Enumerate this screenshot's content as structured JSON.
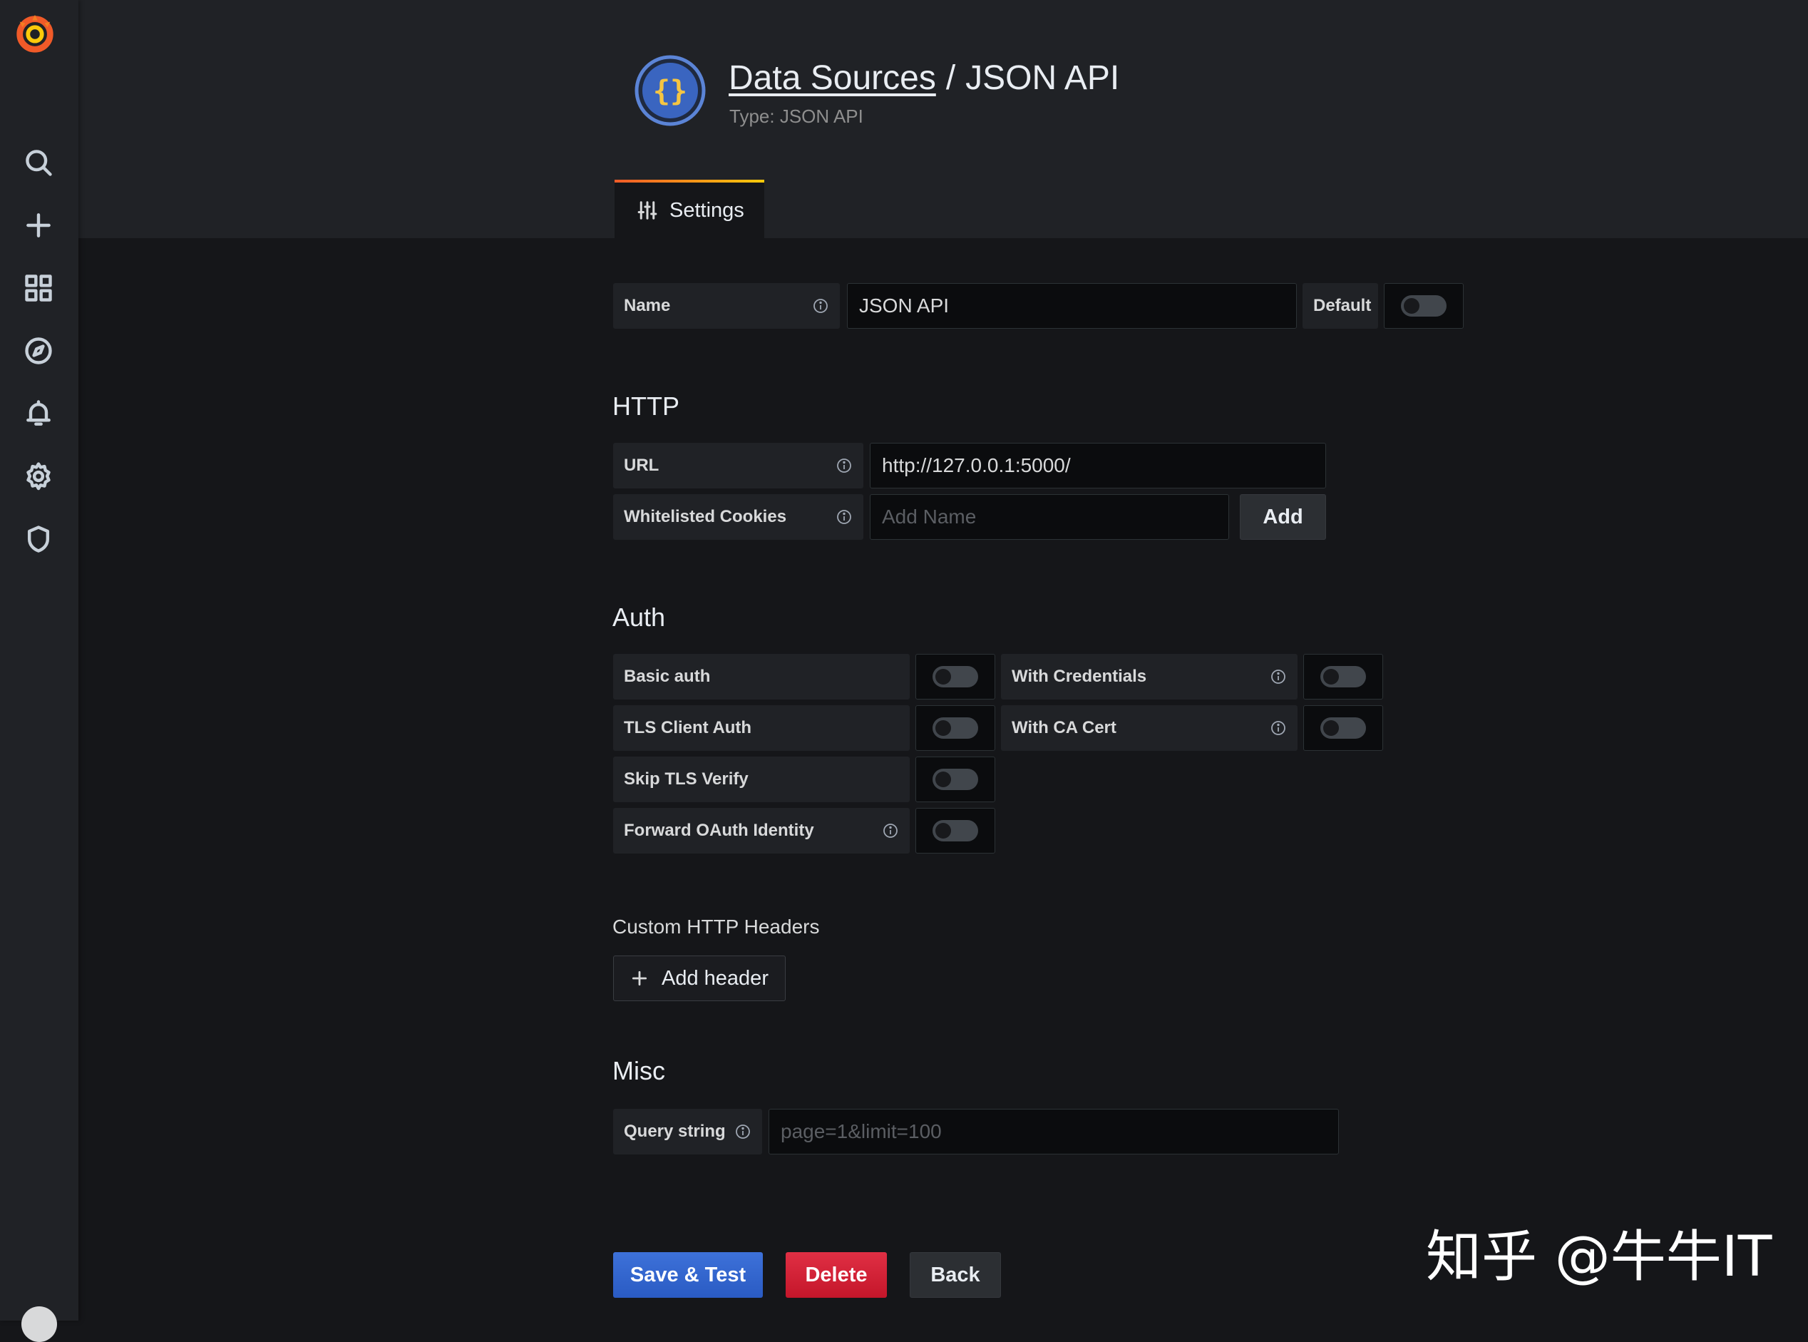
{
  "header": {
    "breadcrumb_link": "Data Sources",
    "breadcrumb_sep": "/",
    "title": "JSON API",
    "subtitle": "Type: JSON API",
    "tab_settings": "Settings"
  },
  "sidemenu": {
    "icons": [
      "grafana-logo-icon",
      "search-icon",
      "plus-icon",
      "dashboards-icon",
      "explore-compass-icon",
      "alerting-bell-icon",
      "configuration-gear-icon",
      "server-admin-shield-icon"
    ]
  },
  "name_row": {
    "label": "Name",
    "value": "JSON API",
    "default_label": "Default",
    "default_on": false
  },
  "http": {
    "title": "HTTP",
    "url_label": "URL",
    "url_value": "http://127.0.0.1:5000/",
    "cookies_label": "Whitelisted Cookies",
    "cookies_placeholder": "Add Name",
    "add_label": "Add"
  },
  "auth": {
    "title": "Auth",
    "basic_auth": "Basic auth",
    "with_credentials": "With Credentials",
    "tls_client_auth": "TLS Client Auth",
    "with_ca_cert": "With CA Cert",
    "skip_tls_verify": "Skip TLS Verify",
    "forward_oauth": "Forward OAuth Identity"
  },
  "headers": {
    "title": "Custom HTTP Headers",
    "add_header": "Add header"
  },
  "misc": {
    "title": "Misc",
    "query_label": "Query string",
    "query_placeholder": "page=1&limit=100"
  },
  "actions": {
    "save": "Save & Test",
    "delete": "Delete",
    "back": "Back"
  },
  "colors": {
    "primary": "#3d71d9",
    "danger": "#e02f44",
    "accent": "#f05a28"
  },
  "watermark": "知乎 @牛牛IT"
}
